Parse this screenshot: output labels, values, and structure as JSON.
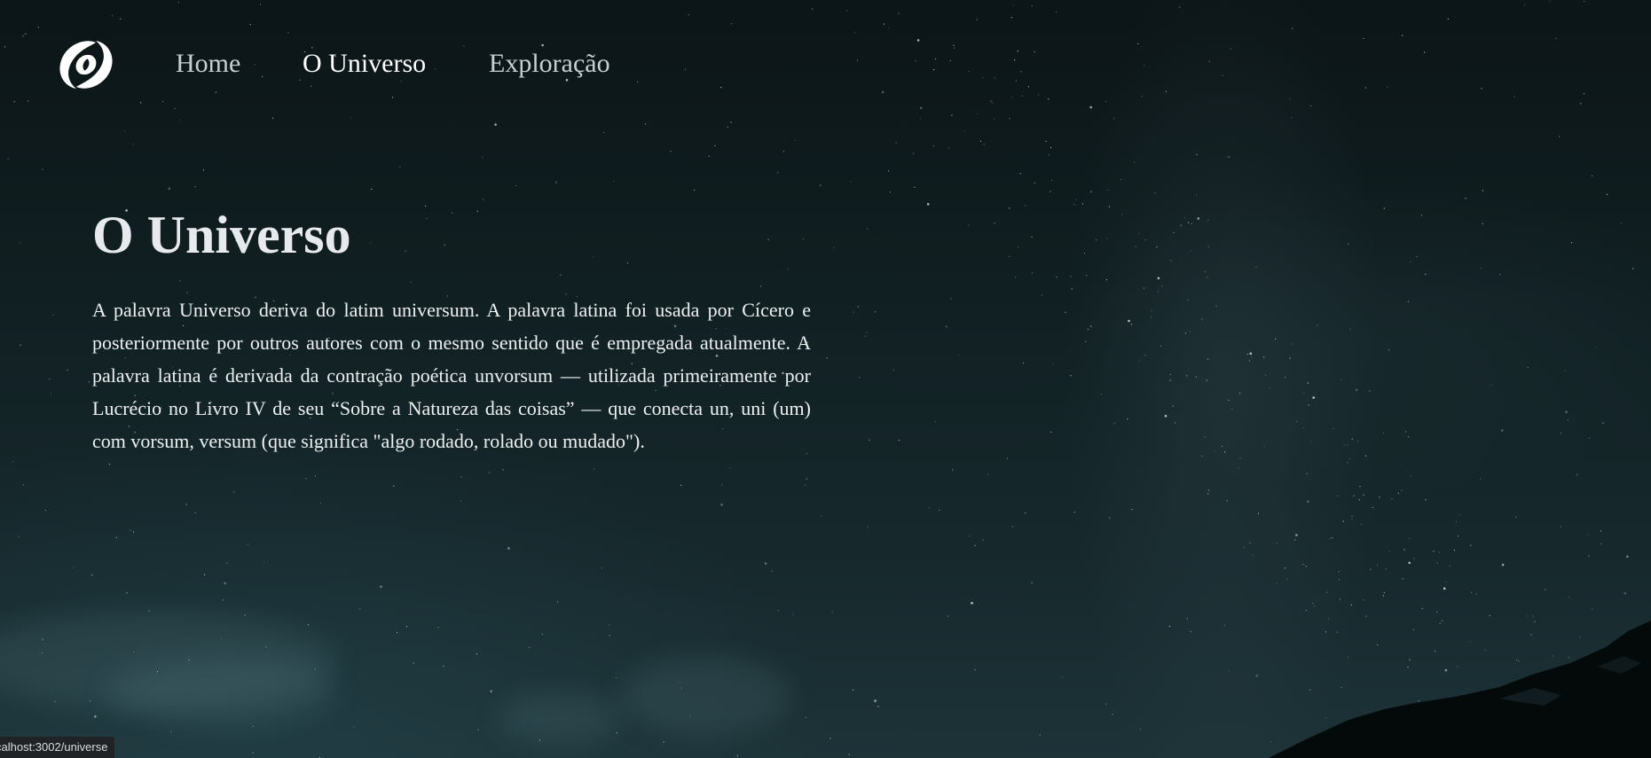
{
  "background": {
    "scene": "night-sky-milky-way",
    "colors": {
      "sky_top": "#0c1517",
      "sky_bottom": "#1d3338",
      "mountain": "#04090a"
    }
  },
  "nav": {
    "logo_icon": "spiral-galaxy-icon",
    "items": [
      {
        "label": "Home",
        "active": false
      },
      {
        "label": "O Universo",
        "active": true
      },
      {
        "label": "Exploração",
        "active": false
      }
    ]
  },
  "main": {
    "title": "O Universo",
    "paragraph": "A palavra Universo deriva do latim universum. A palavra latina foi usada por Cícero e posteriormente por outros autores com o mesmo sentido que é empregada atualmente. A palavra latina é derivada da contração poética unvorsum — utilizada primeiramente por Lucrécio no Livro IV de seu “Sobre a Natureza das coisas” — que conecta un, uni (um) com vorsum, versum (que significa \"algo rodado, rolado ou mudado\")."
  },
  "status_bar": {
    "url": "calhost:3002/universe"
  }
}
